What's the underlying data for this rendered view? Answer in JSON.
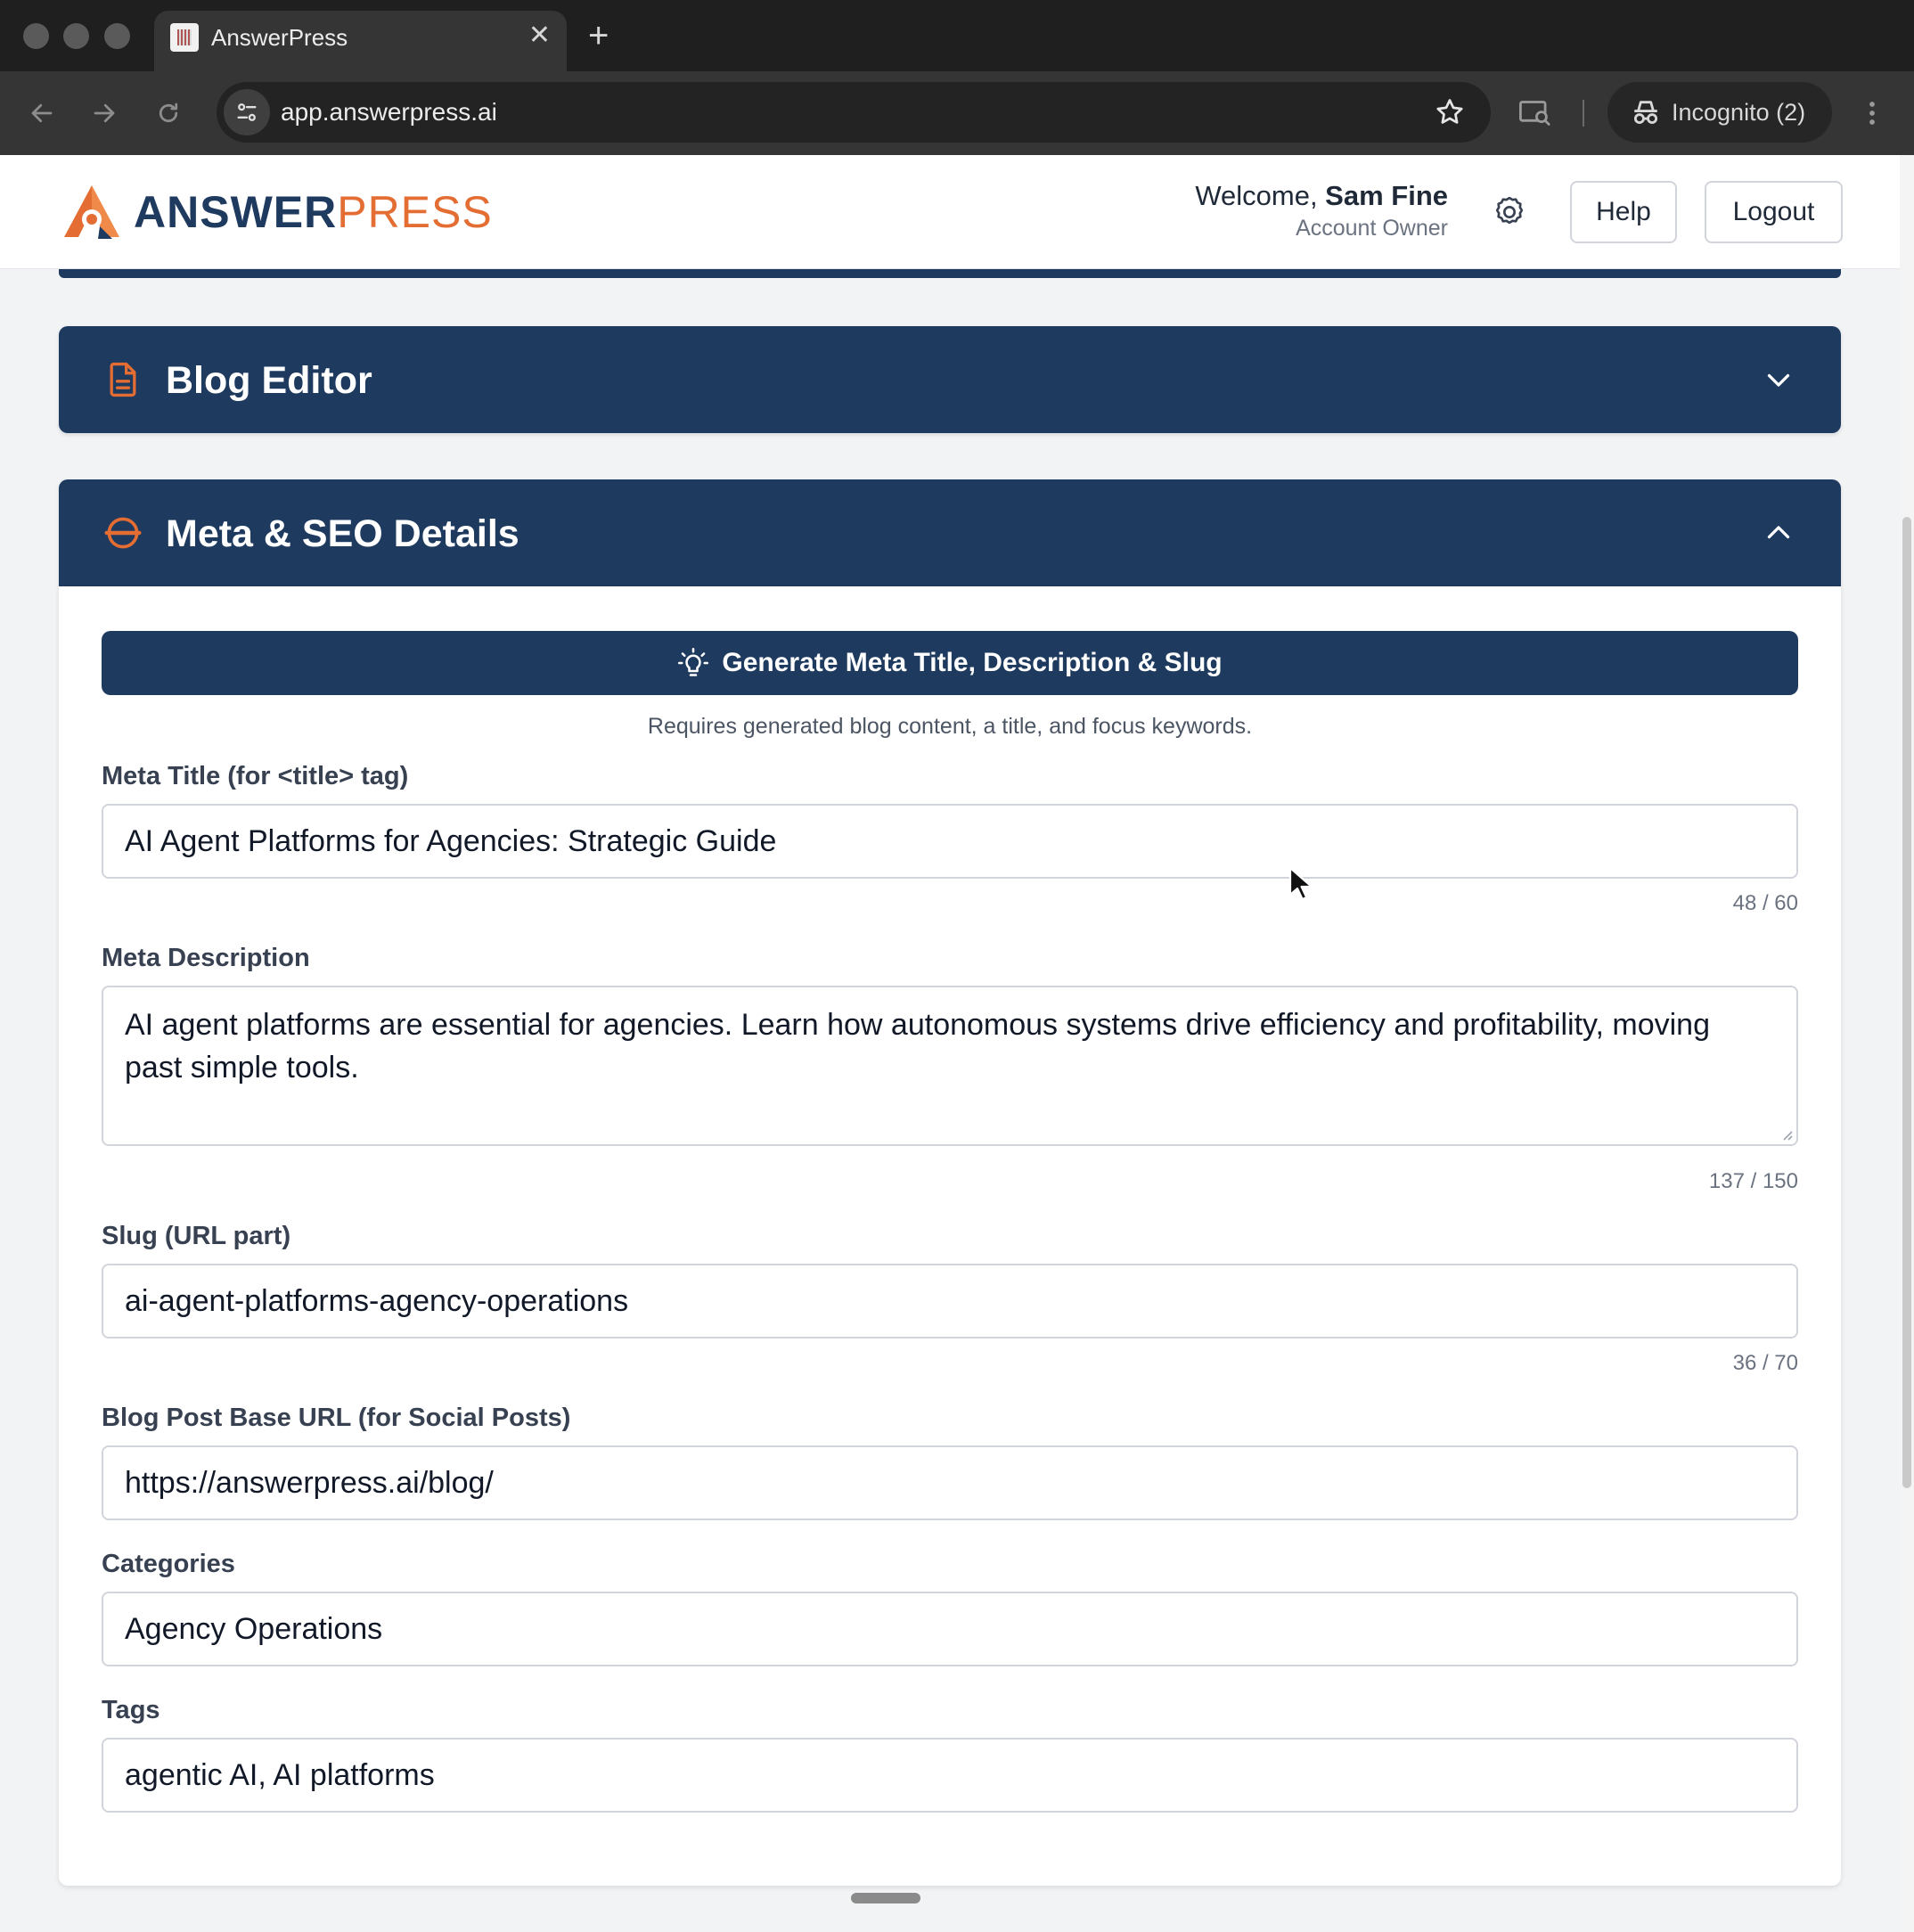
{
  "browser": {
    "tab_title": "AnswerPress",
    "tab_close": "✕",
    "new_tab": "+",
    "url": "app.answerpress.ai",
    "profile_label": "Incognito (2)"
  },
  "header": {
    "logo_part1": "ANSWER",
    "logo_part2": "PRESS",
    "welcome_prefix": "Welcome, ",
    "user_name": "Sam Fine",
    "user_role": "Account Owner",
    "help_label": "Help",
    "logout_label": "Logout"
  },
  "panels": {
    "blog_editor": {
      "title": "Blog Editor",
      "state": "collapsed"
    },
    "meta_seo": {
      "title": "Meta & SEO Details",
      "state": "expanded"
    }
  },
  "meta_seo": {
    "generate_label": "Generate Meta Title, Description & Slug",
    "hint": "Requires generated blog content, a title, and focus keywords.",
    "meta_title": {
      "label": "Meta Title (for <title> tag)",
      "value": "AI Agent Platforms for Agencies: Strategic Guide",
      "counter": "48 / 60"
    },
    "meta_description": {
      "label": "Meta Description",
      "value": "AI agent platforms are essential for agencies. Learn how autonomous systems drive efficiency and profitability, moving past simple tools.",
      "counter": "137 / 150"
    },
    "slug": {
      "label": "Slug (URL part)",
      "value": "ai-agent-platforms-agency-operations",
      "counter": "36 / 70"
    },
    "base_url": {
      "label": "Blog Post Base URL (for Social Posts)",
      "value": "https://answerpress.ai/blog/"
    },
    "categories": {
      "label": "Categories",
      "value": "Agency Operations"
    },
    "tags": {
      "label": "Tags",
      "value": "agentic AI, AI platforms"
    }
  },
  "colors": {
    "navy": "#1f3a5f",
    "accent_orange": "#e36d32"
  },
  "icons": {
    "blog_editor": "document-icon",
    "meta_seo": "tag-icon",
    "generate": "lightbulb-icon",
    "settings": "gear-icon"
  }
}
